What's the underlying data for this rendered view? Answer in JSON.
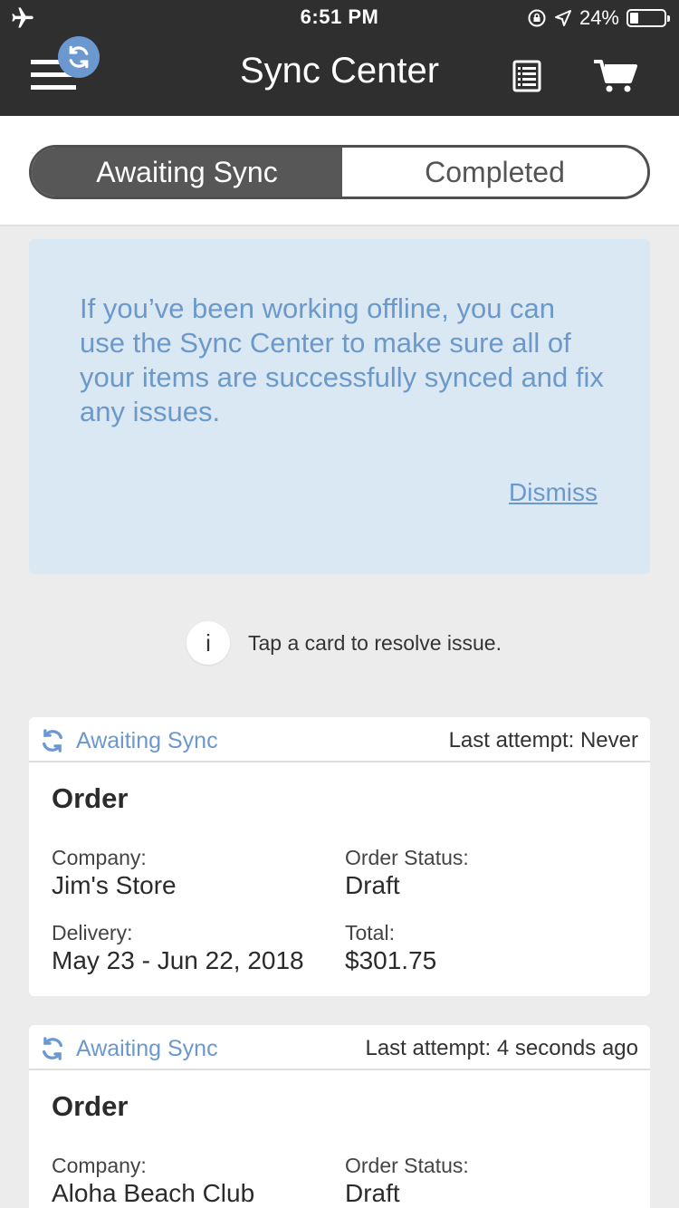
{
  "status_bar": {
    "time": "6:51 PM",
    "battery": "24%",
    "battery_level": 0.24
  },
  "header": {
    "title": "Sync Center",
    "icons": [
      "menu-icon",
      "sync-icon",
      "list-icon",
      "cart-icon"
    ]
  },
  "tabs": [
    {
      "label": "Awaiting Sync",
      "active": true
    },
    {
      "label": "Completed",
      "active": false
    }
  ],
  "info": {
    "message": "If you’ve been working offline, you can use the Sync Center to make sure all of your items are successfully synced and fix any issues.",
    "dismiss": "Dismiss"
  },
  "hint": {
    "icon_text": "i",
    "text": "Tap a card to resolve issue."
  },
  "cards": [
    {
      "status": "Awaiting Sync",
      "last_attempt": "Last attempt: Never",
      "type": "Order",
      "company_label": "Company:",
      "company": "Jim's Store",
      "order_status_label": "Order Status:",
      "order_status": "Draft",
      "delivery_label": "Delivery:",
      "delivery": "May 23 - Jun 22, 2018",
      "total_label": "Total:",
      "total": "$301.75"
    },
    {
      "status": "Awaiting Sync",
      "last_attempt": "Last attempt: 4 seconds ago",
      "type": "Order",
      "company_label": "Company:",
      "company": "Aloha Beach Club",
      "order_status_label": "Order Status:",
      "order_status": "Draft"
    }
  ],
  "colors": {
    "header_bg": "#2f2f2f",
    "accent": "#6a98cf",
    "info_bg": "#dae8f4"
  }
}
